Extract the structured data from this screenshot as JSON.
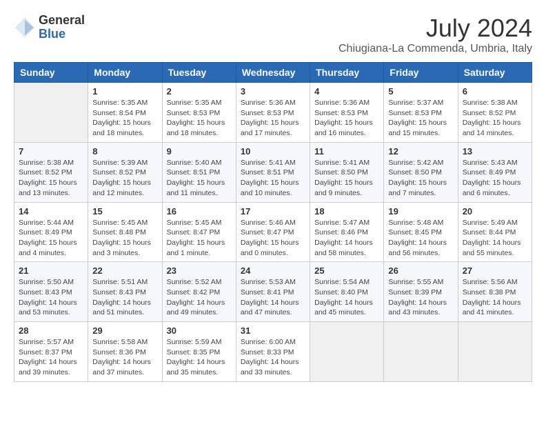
{
  "logo": {
    "general": "General",
    "blue": "Blue"
  },
  "title": "July 2024",
  "subtitle": "Chiugiana-La Commenda, Umbria, Italy",
  "days_header": [
    "Sunday",
    "Monday",
    "Tuesday",
    "Wednesday",
    "Thursday",
    "Friday",
    "Saturday"
  ],
  "weeks": [
    [
      {
        "day": "",
        "details": ""
      },
      {
        "day": "1",
        "details": "Sunrise: 5:35 AM\nSunset: 8:54 PM\nDaylight: 15 hours\nand 18 minutes."
      },
      {
        "day": "2",
        "details": "Sunrise: 5:35 AM\nSunset: 8:53 PM\nDaylight: 15 hours\nand 18 minutes."
      },
      {
        "day": "3",
        "details": "Sunrise: 5:36 AM\nSunset: 8:53 PM\nDaylight: 15 hours\nand 17 minutes."
      },
      {
        "day": "4",
        "details": "Sunrise: 5:36 AM\nSunset: 8:53 PM\nDaylight: 15 hours\nand 16 minutes."
      },
      {
        "day": "5",
        "details": "Sunrise: 5:37 AM\nSunset: 8:53 PM\nDaylight: 15 hours\nand 15 minutes."
      },
      {
        "day": "6",
        "details": "Sunrise: 5:38 AM\nSunset: 8:52 PM\nDaylight: 15 hours\nand 14 minutes."
      }
    ],
    [
      {
        "day": "7",
        "details": "Sunrise: 5:38 AM\nSunset: 8:52 PM\nDaylight: 15 hours\nand 13 minutes."
      },
      {
        "day": "8",
        "details": "Sunrise: 5:39 AM\nSunset: 8:52 PM\nDaylight: 15 hours\nand 12 minutes."
      },
      {
        "day": "9",
        "details": "Sunrise: 5:40 AM\nSunset: 8:51 PM\nDaylight: 15 hours\nand 11 minutes."
      },
      {
        "day": "10",
        "details": "Sunrise: 5:41 AM\nSunset: 8:51 PM\nDaylight: 15 hours\nand 10 minutes."
      },
      {
        "day": "11",
        "details": "Sunrise: 5:41 AM\nSunset: 8:50 PM\nDaylight: 15 hours\nand 9 minutes."
      },
      {
        "day": "12",
        "details": "Sunrise: 5:42 AM\nSunset: 8:50 PM\nDaylight: 15 hours\nand 7 minutes."
      },
      {
        "day": "13",
        "details": "Sunrise: 5:43 AM\nSunset: 8:49 PM\nDaylight: 15 hours\nand 6 minutes."
      }
    ],
    [
      {
        "day": "14",
        "details": "Sunrise: 5:44 AM\nSunset: 8:49 PM\nDaylight: 15 hours\nand 4 minutes."
      },
      {
        "day": "15",
        "details": "Sunrise: 5:45 AM\nSunset: 8:48 PM\nDaylight: 15 hours\nand 3 minutes."
      },
      {
        "day": "16",
        "details": "Sunrise: 5:45 AM\nSunset: 8:47 PM\nDaylight: 15 hours\nand 1 minute."
      },
      {
        "day": "17",
        "details": "Sunrise: 5:46 AM\nSunset: 8:47 PM\nDaylight: 15 hours\nand 0 minutes."
      },
      {
        "day": "18",
        "details": "Sunrise: 5:47 AM\nSunset: 8:46 PM\nDaylight: 14 hours\nand 58 minutes."
      },
      {
        "day": "19",
        "details": "Sunrise: 5:48 AM\nSunset: 8:45 PM\nDaylight: 14 hours\nand 56 minutes."
      },
      {
        "day": "20",
        "details": "Sunrise: 5:49 AM\nSunset: 8:44 PM\nDaylight: 14 hours\nand 55 minutes."
      }
    ],
    [
      {
        "day": "21",
        "details": "Sunrise: 5:50 AM\nSunset: 8:43 PM\nDaylight: 14 hours\nand 53 minutes."
      },
      {
        "day": "22",
        "details": "Sunrise: 5:51 AM\nSunset: 8:43 PM\nDaylight: 14 hours\nand 51 minutes."
      },
      {
        "day": "23",
        "details": "Sunrise: 5:52 AM\nSunset: 8:42 PM\nDaylight: 14 hours\nand 49 minutes."
      },
      {
        "day": "24",
        "details": "Sunrise: 5:53 AM\nSunset: 8:41 PM\nDaylight: 14 hours\nand 47 minutes."
      },
      {
        "day": "25",
        "details": "Sunrise: 5:54 AM\nSunset: 8:40 PM\nDaylight: 14 hours\nand 45 minutes."
      },
      {
        "day": "26",
        "details": "Sunrise: 5:55 AM\nSunset: 8:39 PM\nDaylight: 14 hours\nand 43 minutes."
      },
      {
        "day": "27",
        "details": "Sunrise: 5:56 AM\nSunset: 8:38 PM\nDaylight: 14 hours\nand 41 minutes."
      }
    ],
    [
      {
        "day": "28",
        "details": "Sunrise: 5:57 AM\nSunset: 8:37 PM\nDaylight: 14 hours\nand 39 minutes."
      },
      {
        "day": "29",
        "details": "Sunrise: 5:58 AM\nSunset: 8:36 PM\nDaylight: 14 hours\nand 37 minutes."
      },
      {
        "day": "30",
        "details": "Sunrise: 5:59 AM\nSunset: 8:35 PM\nDaylight: 14 hours\nand 35 minutes."
      },
      {
        "day": "31",
        "details": "Sunrise: 6:00 AM\nSunset: 8:33 PM\nDaylight: 14 hours\nand 33 minutes."
      },
      {
        "day": "",
        "details": ""
      },
      {
        "day": "",
        "details": ""
      },
      {
        "day": "",
        "details": ""
      }
    ]
  ]
}
